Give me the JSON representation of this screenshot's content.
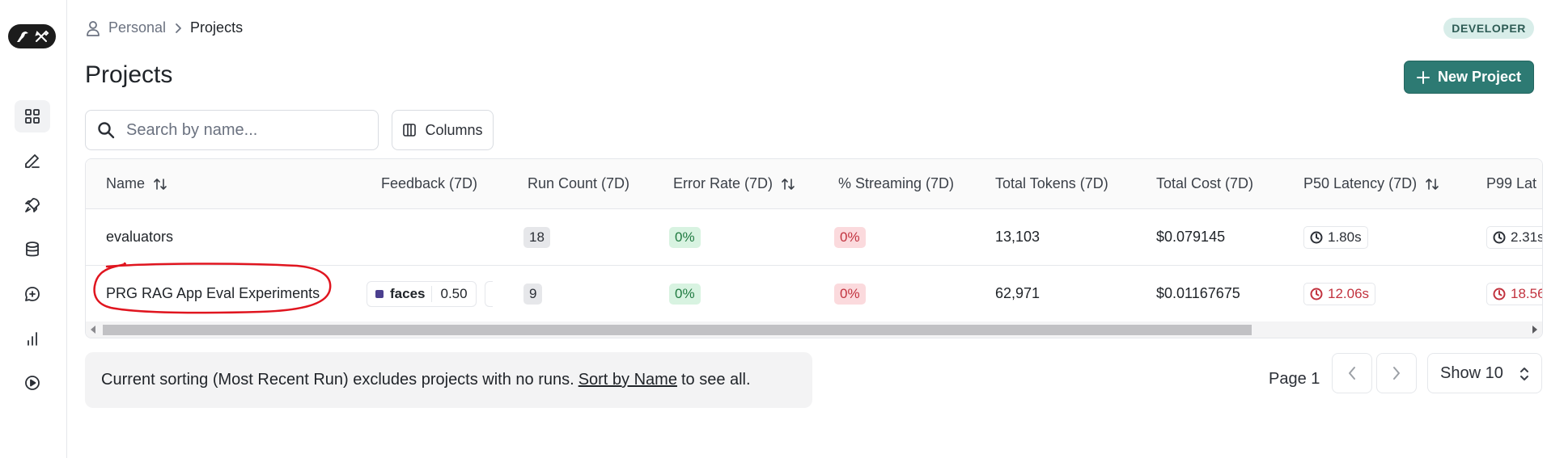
{
  "breadcrumb": {
    "parent": "Personal",
    "current": "Projects"
  },
  "badge": "DEVELOPER",
  "page_title": "Projects",
  "new_project_label": "New Project",
  "search": {
    "placeholder": "Search by name..."
  },
  "columns_label": "Columns",
  "table": {
    "headers": [
      "Name",
      "Feedback (7D)",
      "Run Count (7D)",
      "Error Rate (7D)",
      "% Streaming (7D)",
      "Total Tokens (7D)",
      "Total Cost (7D)",
      "P50 Latency (7D)",
      "P99 Lat"
    ],
    "rows": [
      {
        "name": "evaluators",
        "feedback": null,
        "run_count": "18",
        "error_rate": "0%",
        "streaming": "0%",
        "total_tokens": "13,103",
        "total_cost": "$0.079145",
        "p50": "1.80s",
        "p99": "2.31s"
      },
      {
        "name": "PRG RAG App Eval Experiments",
        "feedback": {
          "key": "faces",
          "value": "0.50"
        },
        "run_count": "9",
        "error_rate": "0%",
        "streaming": "0%",
        "total_tokens": "62,971",
        "total_cost": "$0.01167675",
        "p50": "12.06s",
        "p99": "18.56"
      }
    ]
  },
  "notice": {
    "before": "Current sorting (Most Recent Run) excludes projects with no runs.",
    "link": "Sort by Name",
    "after": "to see all."
  },
  "pagination": {
    "page_label": "Page 1",
    "show_label": "Show 10"
  },
  "colors": {
    "accent": "#2d7a73",
    "annotation": "#e0151f",
    "error": "#c2333f",
    "success": "#1f7a40"
  },
  "sidebar_icons": [
    "grid-icon",
    "pen-icon",
    "rocket-icon",
    "database-icon",
    "chat-plus-icon",
    "bar-chart-icon",
    "play-circle-icon"
  ]
}
